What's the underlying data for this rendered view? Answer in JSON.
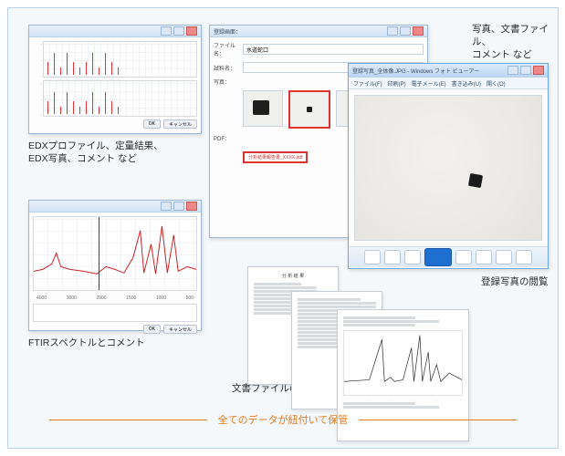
{
  "captions": {
    "edx": "EDXプロファイル、定量結果、\nEDX写真、コメント など",
    "ftir": "FTIRスペクトルとコメント",
    "docs": "文書ファイルの閲覧",
    "photos": "写真、文書ファイル、\nコメント など",
    "viewer": "登録写真の閲覧"
  },
  "footer": {
    "label": "全てのデータが紐付いて保管"
  },
  "ftir_chart": {
    "x_ticks": [
      "4000",
      "3000",
      "2000",
      "1500",
      "1000",
      "500"
    ]
  },
  "register_window": {
    "title_prefix": "登録画面：",
    "file_label": "ファイル名：",
    "file_value": "水道蛇口",
    "sample_label": "試料名：",
    "photo_label": "写真：",
    "pdf_label": "PDF：",
    "pdf_value": "分析結果報告書_XXXX.pdf"
  },
  "photo_viewer": {
    "title": "登録写真_全体像.JPG - Windows フォト ビューアー",
    "menu": [
      "ファイル(F)",
      "印刷(P)",
      "電子メール(E)",
      "書き込み(U)",
      "開く(O)"
    ]
  },
  "doc_stack": {
    "report_title": "分 析 結 果"
  },
  "buttons": {
    "ok": "OK",
    "cancel": "キャンセル"
  }
}
